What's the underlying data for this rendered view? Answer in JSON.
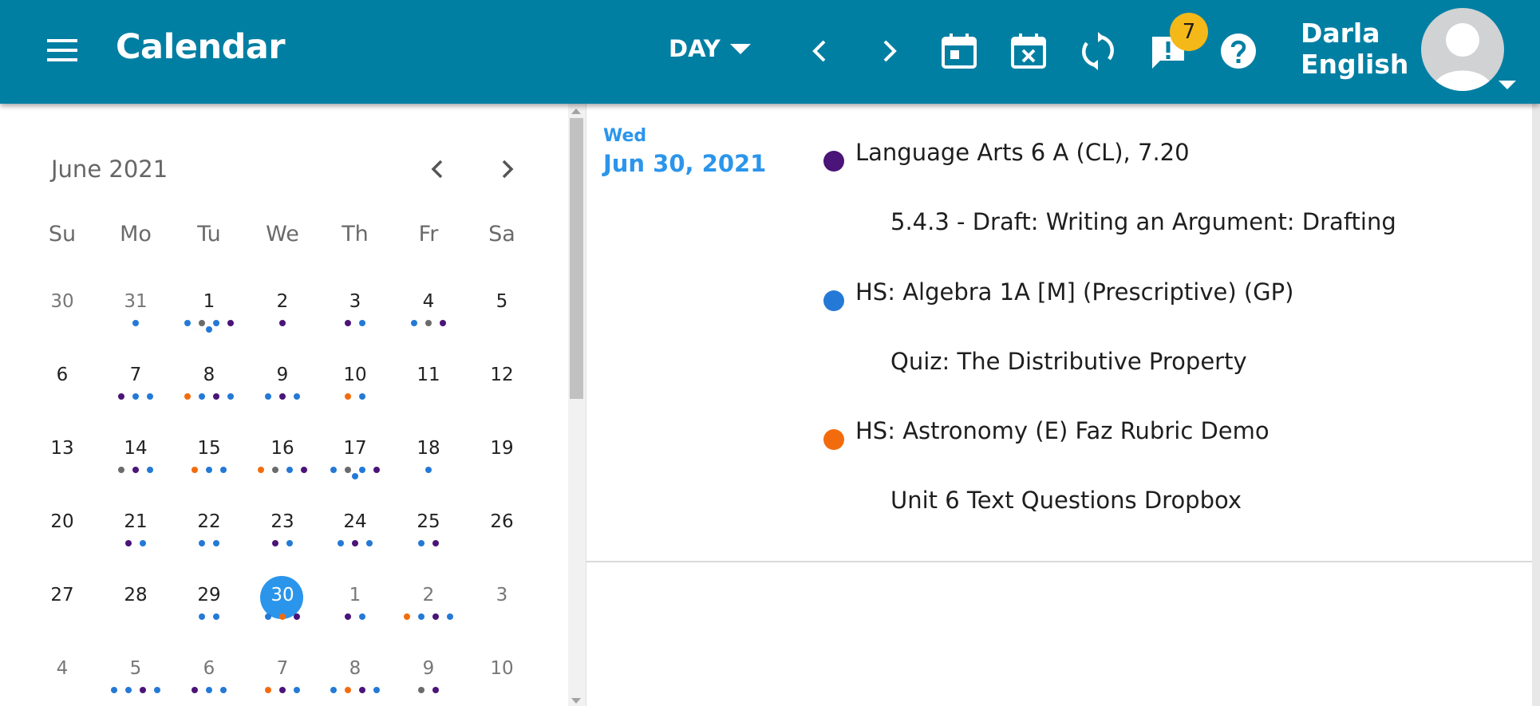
{
  "header": {
    "app_title": "Calendar",
    "view_mode": "DAY",
    "notification_count": "7",
    "user_first_name": "Darla",
    "user_last_name": "English",
    "icons": [
      "menu-icon",
      "previous-icon",
      "next-icon",
      "today-icon",
      "clear-date-icon",
      "sync-icon",
      "alerts-icon",
      "help-icon",
      "avatar-icon"
    ],
    "bar_color": "#007fa3",
    "badge_color": "#f4b818"
  },
  "mini_calendar": {
    "month_label": "June 2021",
    "weekdays": [
      "Su",
      "Mo",
      "Tu",
      "We",
      "Th",
      "Fr",
      "Sa"
    ],
    "selected_color": "#2b95eb",
    "weeks": [
      [
        {
          "d": "30",
          "other": true,
          "dots": []
        },
        {
          "d": "31",
          "other": true,
          "dots": [
            "blue"
          ]
        },
        {
          "d": "1",
          "dots": [
            "blue",
            "gray",
            "blue",
            "purple",
            "blue"
          ]
        },
        {
          "d": "2",
          "dots": [
            "purple"
          ]
        },
        {
          "d": "3",
          "dots": [
            "purple",
            "blue"
          ]
        },
        {
          "d": "4",
          "dots": [
            "blue",
            "gray",
            "purple"
          ]
        },
        {
          "d": "5",
          "dots": []
        }
      ],
      [
        {
          "d": "6",
          "dots": []
        },
        {
          "d": "7",
          "dots": [
            "purple",
            "blue",
            "blue"
          ]
        },
        {
          "d": "8",
          "dots": [
            "orange",
            "blue",
            "purple",
            "blue"
          ]
        },
        {
          "d": "9",
          "dots": [
            "blue",
            "purple",
            "blue"
          ]
        },
        {
          "d": "10",
          "dots": [
            "orange",
            "blue"
          ]
        },
        {
          "d": "11",
          "dots": []
        },
        {
          "d": "12",
          "dots": []
        }
      ],
      [
        {
          "d": "13",
          "dots": []
        },
        {
          "d": "14",
          "dots": [
            "gray",
            "purple",
            "blue"
          ]
        },
        {
          "d": "15",
          "dots": [
            "orange",
            "blue",
            "blue"
          ]
        },
        {
          "d": "16",
          "dots": [
            "orange",
            "gray",
            "blue",
            "purple"
          ]
        },
        {
          "d": "17",
          "dots": [
            "blue",
            "gray",
            "blue",
            "purple",
            "blue"
          ]
        },
        {
          "d": "18",
          "dots": [
            "blue"
          ]
        },
        {
          "d": "19",
          "dots": []
        }
      ],
      [
        {
          "d": "20",
          "dots": []
        },
        {
          "d": "21",
          "dots": [
            "purple",
            "blue"
          ]
        },
        {
          "d": "22",
          "dots": [
            "blue",
            "blue"
          ]
        },
        {
          "d": "23",
          "dots": [
            "purple",
            "blue"
          ]
        },
        {
          "d": "24",
          "dots": [
            "blue",
            "purple",
            "blue"
          ]
        },
        {
          "d": "25",
          "dots": [
            "blue",
            "purple"
          ]
        },
        {
          "d": "26",
          "dots": []
        }
      ],
      [
        {
          "d": "27",
          "dots": []
        },
        {
          "d": "28",
          "dots": []
        },
        {
          "d": "29",
          "dots": [
            "blue",
            "blue"
          ]
        },
        {
          "d": "30",
          "selected": true,
          "dots": [
            "blue",
            "orange",
            "purple"
          ]
        },
        {
          "d": "1",
          "other": true,
          "dots": [
            "purple",
            "blue"
          ]
        },
        {
          "d": "2",
          "other": true,
          "dots": [
            "orange",
            "blue",
            "purple",
            "blue"
          ]
        },
        {
          "d": "3",
          "other": true,
          "dots": []
        }
      ],
      [
        {
          "d": "4",
          "other": true,
          "dots": []
        },
        {
          "d": "5",
          "other": true,
          "dots": [
            "blue",
            "blue",
            "purple",
            "blue"
          ]
        },
        {
          "d": "6",
          "other": true,
          "dots": [
            "purple",
            "blue",
            "blue"
          ]
        },
        {
          "d": "7",
          "other": true,
          "dots": [
            "orange",
            "purple",
            "blue"
          ]
        },
        {
          "d": "8",
          "other": true,
          "dots": [
            "blue",
            "orange",
            "purple",
            "blue"
          ]
        },
        {
          "d": "9",
          "other": true,
          "dots": [
            "gray",
            "purple"
          ]
        },
        {
          "d": "10",
          "other": true,
          "dots": []
        }
      ]
    ],
    "dot_colors": {
      "blue": "#2479d6",
      "purple": "#4a1478",
      "orange": "#f26c0e",
      "gray": "#6b6b6b"
    }
  },
  "day_view": {
    "weekday": "Wed",
    "date": "Jun 30, 2021",
    "events": [
      {
        "course": "Language Arts 6 A (CL), 7.20",
        "title": "5.4.3 - Draft: Writing an Argument: Drafting",
        "color": "#4a1478"
      },
      {
        "course": "HS: Algebra 1A [M] (Prescriptive) (GP)",
        "title": "Quiz: The Distributive Property",
        "color": "#2479d6"
      },
      {
        "course": "HS: Astronomy (E) Faz Rubric Demo",
        "title": "Unit 6 Text Questions Dropbox",
        "color": "#f26c0e"
      }
    ]
  }
}
